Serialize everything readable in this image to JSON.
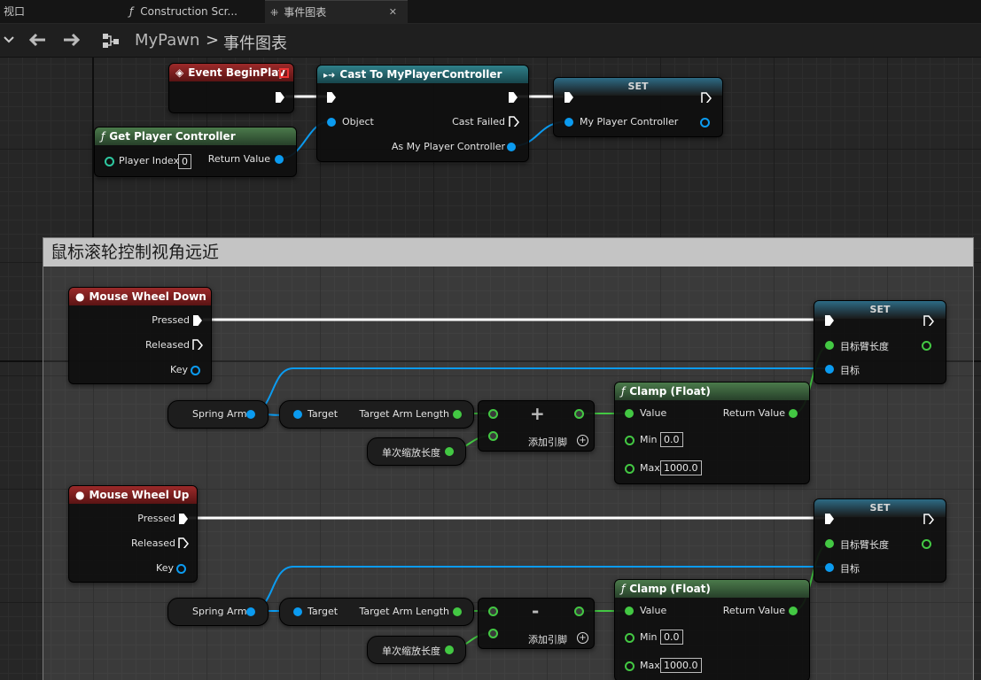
{
  "tabs": [
    {
      "label": "视口",
      "icon": ""
    },
    {
      "label": "Construction Scr...",
      "icon": "function-icon"
    },
    {
      "label": "事件图表",
      "icon": "graph-icon",
      "close": "✕"
    }
  ],
  "toolbar": {
    "breadcrumb_root": "MyPawn",
    "breadcrumb_sep": ">",
    "breadcrumb_current": "事件图表"
  },
  "comment": {
    "title": "鼠标滚轮控制视角远近"
  },
  "nodes": {
    "begin_play": {
      "title": "Event BeginPlay"
    },
    "cast": {
      "title": "Cast To MyPlayerController",
      "object": "Object",
      "cast_failed": "Cast Failed",
      "as_pc": "As My Player Controller"
    },
    "set_top": {
      "title": "SET",
      "pin": "My Player Controller"
    },
    "get_pc": {
      "title": "Get Player Controller",
      "player_index": "Player Index",
      "player_index_value": "0",
      "return_value": "Return Value"
    },
    "wheel_down": {
      "title": "Mouse Wheel Down",
      "pressed": "Pressed",
      "released": "Released",
      "key": "Key"
    },
    "set_down": {
      "title": "SET",
      "pin1": "目标臂长度",
      "pin2": "目标"
    },
    "spring_arm_down": {
      "label": "Spring Arm"
    },
    "get_arm_down": {
      "target": "Target",
      "output": "Target Arm Length"
    },
    "zoom_down": {
      "label": "单次缩放长度"
    },
    "add": {
      "symbol": "+",
      "add_pin": "添加引脚"
    },
    "clamp_down": {
      "title": "Clamp (Float)",
      "value": "Value",
      "return_value": "Return Value",
      "min": "Min",
      "min_value": "0.0",
      "max": "Max",
      "max_value": "1000.0"
    },
    "wheel_up": {
      "title": "Mouse Wheel Up",
      "pressed": "Pressed",
      "released": "Released",
      "key": "Key"
    },
    "set_up": {
      "title": "SET",
      "pin1": "目标臂长度",
      "pin2": "目标"
    },
    "spring_arm_up": {
      "label": "Spring Arm"
    },
    "get_arm_up": {
      "target": "Target",
      "output": "Target Arm Length"
    },
    "zoom_up": {
      "label": "单次缩放长度"
    },
    "sub": {
      "symbol": "-",
      "add_pin": "添加引脚"
    },
    "clamp_up": {
      "title": "Clamp (Float)",
      "value": "Value",
      "return_value": "Return Value",
      "min": "Min",
      "min_value": "0.0",
      "max": "Max",
      "max_value": "1000.0"
    }
  },
  "colors": {
    "exec": "#ffffff",
    "object_pin": "#0b9bf0",
    "float_pin": "#43c843",
    "int_pin": "#2ec8a0",
    "event_header": "#9c2a2a",
    "cast_header": "#2f7f88",
    "function_header": "#4b7a4b"
  }
}
